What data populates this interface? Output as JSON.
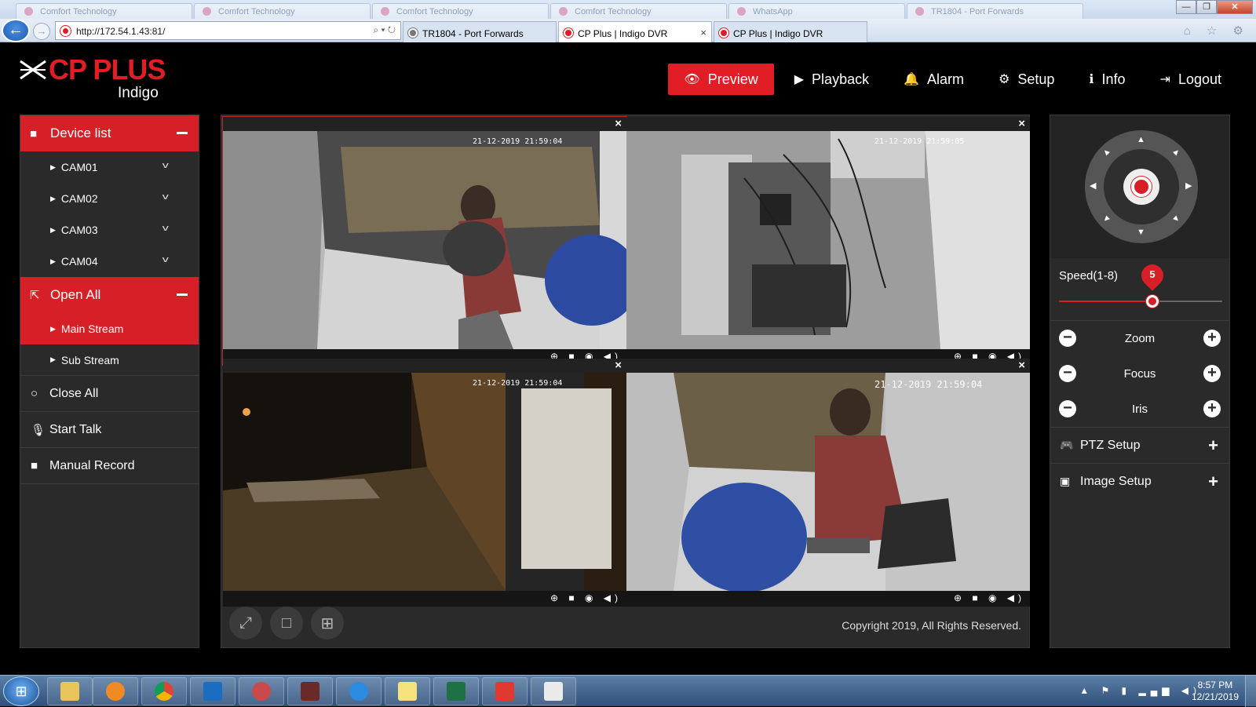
{
  "browser": {
    "ghost_tabs": [
      "Comfort Technology",
      "Comfort Technology",
      "Comfort Technology",
      "Comfort Technology",
      "WhatsApp",
      "TR1804 - Port Forwards"
    ],
    "window_buttons": {
      "minimize": "—",
      "restore": "❐",
      "close": "✕"
    },
    "back": "←",
    "forward": "→",
    "address": "http://172.54.1.43:81/",
    "address_tools": "⌕ ▾ ↻",
    "tabs": [
      {
        "label": "TR1804 - Port Forwards"
      },
      {
        "label": "CP Plus | Indigo DVR",
        "close": "×"
      },
      {
        "label": "CP Plus | Indigo DVR"
      }
    ],
    "icons": "⌂ ☆ ⚙"
  },
  "header": {
    "brand": "CP PLUS",
    "sub": "Indigo",
    "nav": [
      {
        "label": "Preview",
        "icon": "👁",
        "active": true
      },
      {
        "label": "Playback",
        "icon": "▶"
      },
      {
        "label": "Alarm",
        "icon": "🔔"
      },
      {
        "label": "Setup",
        "icon": "⚙"
      },
      {
        "label": "Info",
        "icon": "ℹ"
      },
      {
        "label": "Logout",
        "icon": "⇥"
      }
    ]
  },
  "sidebar": {
    "device_list": "Device list",
    "cameras": [
      "CAM01",
      "CAM02",
      "CAM03",
      "CAM04"
    ],
    "open_all": "Open All",
    "main_stream": "Main Stream",
    "sub_stream": "Sub Stream",
    "close_all": "Close All",
    "start_talk": "Start Talk",
    "manual_record": "Manual Record"
  },
  "video": {
    "close": "×",
    "tiles": [
      {
        "timestamp": "21-12-2019 21:59:04"
      },
      {
        "timestamp": "21-12-2019 21:59:05"
      },
      {
        "timestamp": "21-12-2019 21:59:04"
      },
      {
        "timestamp": "21-12-2019 21:59:04"
      }
    ],
    "tools": "⊕ ■ ◉ ◀)",
    "copyright": "Copyright 2019, All Rights Reserved."
  },
  "ptz": {
    "speed_label": "Speed(1-8)",
    "speed": 5,
    "speed_min": 1,
    "speed_max": 8,
    "zoom": "Zoom",
    "focus": "Focus",
    "iris": "Iris",
    "ptz_setup": "PTZ Setup",
    "image_setup": "Image Setup"
  },
  "taskbar": {
    "start": "⊞",
    "tray": "▲ ⚑ ▮ ▂▄▆ ◀)",
    "time": "8:57 PM",
    "date": "12/21/2019"
  },
  "colors": {
    "accent": "#d61f26",
    "panel": "#2a2a2a"
  }
}
